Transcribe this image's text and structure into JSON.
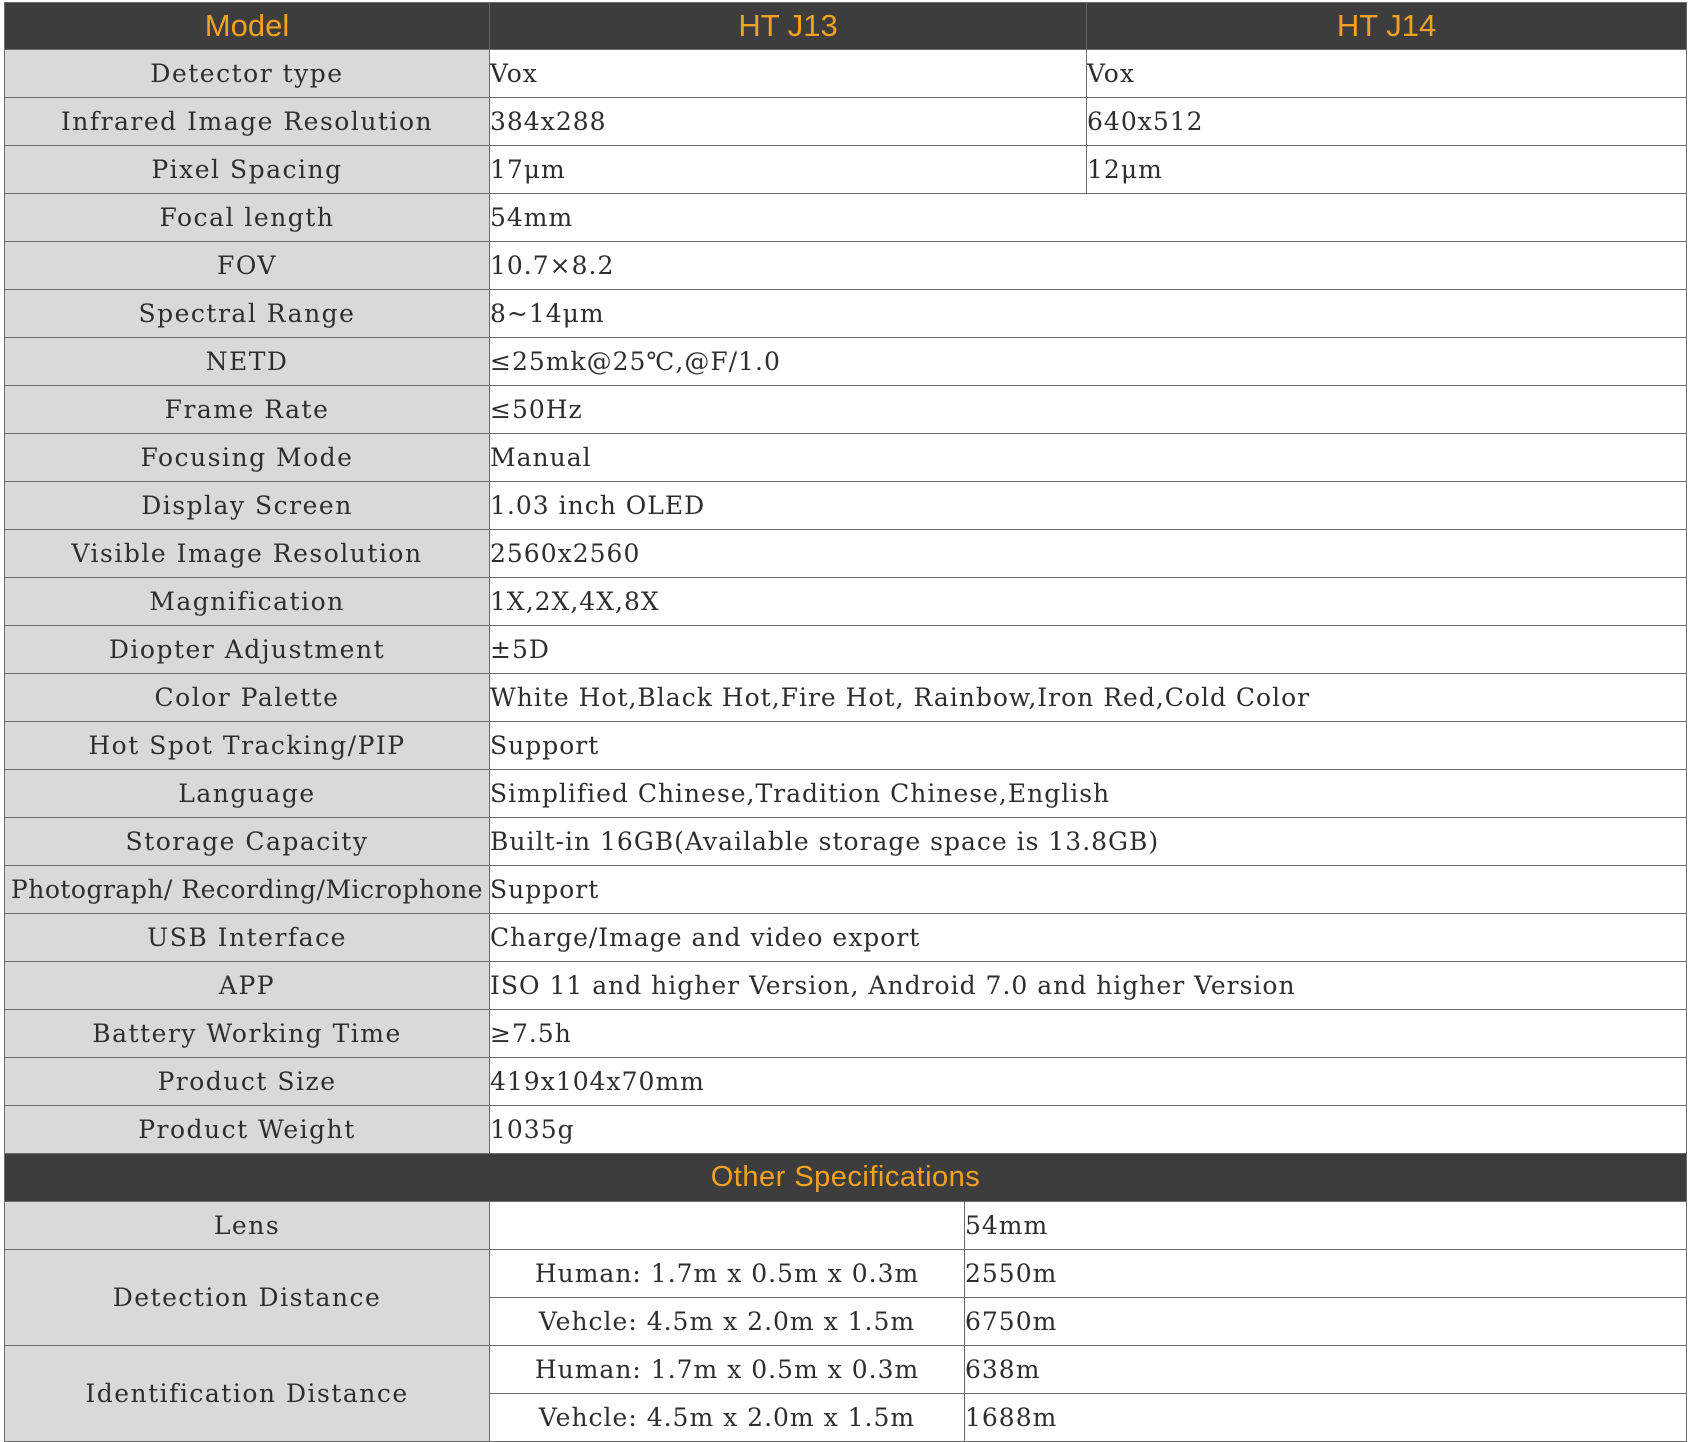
{
  "header": {
    "model_label": "Model",
    "models": [
      "HT J13",
      "HT J14"
    ]
  },
  "specs": [
    {
      "label": "Detector type",
      "values": [
        "Vox",
        "Vox"
      ]
    },
    {
      "label": "Infrared Image Resolution",
      "values": [
        "384x288",
        "640x512"
      ]
    },
    {
      "label": "Pixel Spacing",
      "values": [
        "17μm",
        "12μm"
      ]
    },
    {
      "label": "Focal length",
      "value": "54mm"
    },
    {
      "label": "FOV",
      "value": "10.7×8.2"
    },
    {
      "label": "Spectral Range",
      "value": "8~14μm"
    },
    {
      "label": "NETD",
      "value": "≤25mk@25℃,@F/1.0"
    },
    {
      "label": "Frame Rate",
      "value": "≤50Hz"
    },
    {
      "label": "Focusing Mode",
      "value": "Manual"
    },
    {
      "label": "Display Screen",
      "value": "1.03 inch OLED"
    },
    {
      "label": "Visible Image Resolution",
      "value": "2560x2560"
    },
    {
      "label": "Magnification",
      "value": "1X,2X,4X,8X"
    },
    {
      "label": "Diopter Adjustment",
      "value": "±5D"
    },
    {
      "label": "Color Palette",
      "value": "White Hot,Black Hot,Fire Hot, Rainbow,Iron Red,Cold Color"
    },
    {
      "label": "Hot Spot Tracking/PIP",
      "value": "Support"
    },
    {
      "label": "Language",
      "value": "Simplified Chinese,Tradition Chinese,English"
    },
    {
      "label": "Storage Capacity",
      "value": "Built-in 16GB(Available storage space is 13.8GB)"
    },
    {
      "label": "Photograph/ Recording/Microphone",
      "value": "Support"
    },
    {
      "label": "USB Interface",
      "value": "Charge/Image and video export"
    },
    {
      "label": "APP",
      "value": "ISO 11 and higher Version, Android 7.0 and higher Version"
    },
    {
      "label": "Battery Working Time",
      "value": "≥7.5h"
    },
    {
      "label": "Product Size",
      "value": "419x104x70mm"
    },
    {
      "label": "Product Weight",
      "value": "1035g"
    }
  ],
  "other": {
    "title": "Other Specifications",
    "lens": {
      "label": "Lens",
      "value": "54mm"
    },
    "detection": {
      "label": "Detection Distance",
      "rows": [
        {
          "target": "Human: 1.7m x 0.5m x 0.3m",
          "value": "2550m"
        },
        {
          "target": "Vehcle: 4.5m x 2.0m x 1.5m",
          "value": "6750m"
        }
      ]
    },
    "identification": {
      "label": "Identification Distance",
      "rows": [
        {
          "target": "Human: 1.7m x 0.5m x 0.3m",
          "value": "638m"
        },
        {
          "target": "Vehcle: 4.5m x 2.0m x 1.5m",
          "value": "1688m"
        }
      ]
    }
  }
}
